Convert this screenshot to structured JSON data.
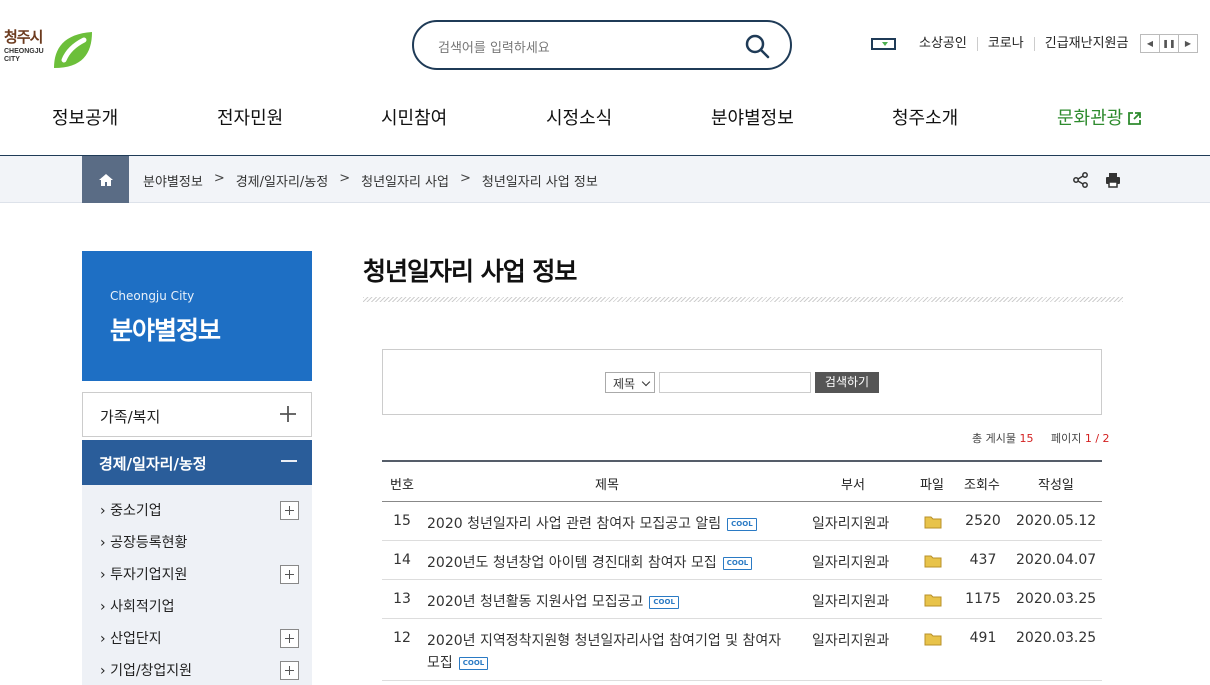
{
  "logo": {
    "name": "청주시",
    "sub1": "CHEONGJU",
    "sub2": "CITY"
  },
  "search": {
    "placeholder": "검색어를 입력하세요"
  },
  "quick_links": [
    "소상공인",
    "코로나",
    "긴급재난지원금"
  ],
  "gnb": [
    "정보공개",
    "전자민원",
    "시민참여",
    "시정소식",
    "분야별정보",
    "청주소개",
    "문화관광"
  ],
  "breadcrumb": [
    "분야별정보",
    "경제/일자리/농정",
    "청년일자리 사업",
    "청년일자리 사업 정보"
  ],
  "lnb": {
    "title_en": "Cheongju City",
    "title_ko": "분야별정보",
    "menu1": "가족/복지",
    "menu2": "경제/일자리/농정",
    "sub": [
      "중소기업",
      "공장등록현황",
      "투자기업지원",
      "사회적기업",
      "산업단지",
      "기업/창업지원"
    ]
  },
  "page_title": "청년일자리 사업 정보",
  "board_search": {
    "select": "제목",
    "button": "검색하기"
  },
  "count": {
    "total_label": "총 게시물",
    "total": "15",
    "page_label": "페이지",
    "page": "1 / 2"
  },
  "table": {
    "headers": [
      "번호",
      "제목",
      "부서",
      "파일",
      "조회수",
      "작성일"
    ],
    "rows": [
      {
        "no": "15",
        "title": "2020 청년일자리 사업 관련 참여자 모집공고 알림",
        "dept": "일자리지원과",
        "views": "2520",
        "date": "2020.05.12"
      },
      {
        "no": "14",
        "title": "2020년도 청년창업 아이템 경진대회 참여자 모집",
        "dept": "일자리지원과",
        "views": "437",
        "date": "2020.04.07"
      },
      {
        "no": "13",
        "title": "2020년 청년활동 지원사업 모집공고",
        "dept": "일자리지원과",
        "views": "1175",
        "date": "2020.03.25"
      },
      {
        "no": "12",
        "title": "2020년 지역정착지원형 청년일자리사업 참여기업 및 참여자 모집",
        "dept": "일자리지원과",
        "views": "491",
        "date": "2020.03.25"
      }
    ],
    "badge": "COOL"
  },
  "colors": {
    "primary": "#1e6fc4",
    "navy": "#1f3b57",
    "active": "#2a5d9a",
    "accent_red": "#d32020",
    "culture_green": "#2e8b2e"
  }
}
